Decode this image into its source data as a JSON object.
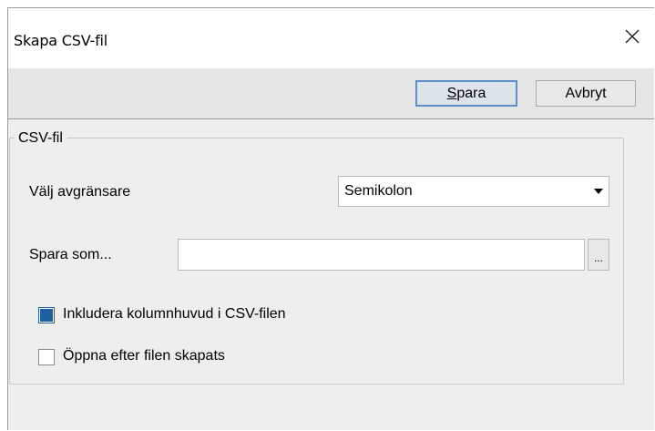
{
  "window": {
    "title": "Skapa CSV-fil",
    "close_icon": "close-icon"
  },
  "toolbar": {
    "save_label_underlined": "S",
    "save_label_rest": "para",
    "cancel_label": "Avbryt"
  },
  "group": {
    "legend": "CSV-fil",
    "delimiter_label": "Välj avgränsare",
    "delimiter_value": "Semikolon",
    "save_as_label": "Spara som...",
    "save_as_value": "",
    "browse_label": "...",
    "include_header_label": "Inkludera kolumnhuvud i CSV-filen",
    "include_header_checked": true,
    "open_after_label": "Öppna efter filen skapats",
    "open_after_checked": false
  },
  "colors": {
    "accent": "#1f5f9e",
    "primary_border": "#5d8fc7",
    "dialog_bg": "#eeeeee",
    "toolbar_bg": "#e6e6e6"
  }
}
